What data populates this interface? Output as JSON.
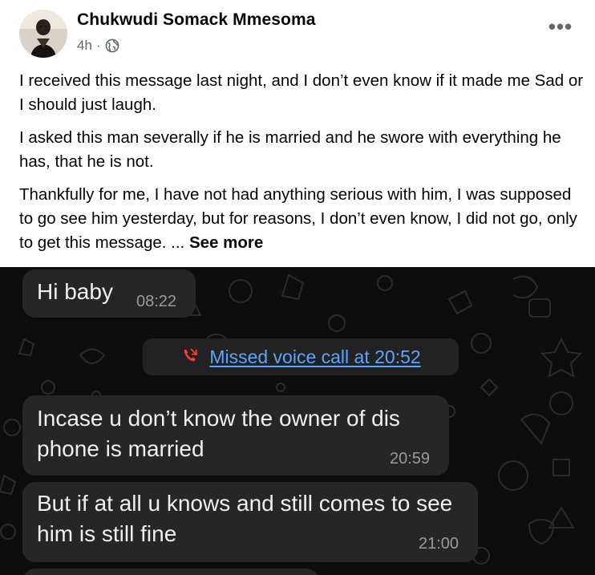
{
  "post": {
    "author_name": "Chukwudi Somack Mmesoma",
    "time": "4h",
    "separator": "·",
    "privacy_icon": "globe-icon",
    "more_icon": "more-horizontal-icon",
    "more_label": "•••",
    "paragraphs": [
      "I received this message last night, and I don’t even know if it made me Sad or I should just laugh.",
      "I asked this man severally if he is married and he swore with everything he has, that he is not.",
      "Thankfully for me, I have not had anything serious with him, I was supposed to go see him yesterday, but for reasons, I don’t even know, I did not go, only to get this message. ..."
    ],
    "see_more": "See more"
  },
  "chat": {
    "colors": {
      "background": "#0d0d0d",
      "bubble": "#262626",
      "link": "#5aa5ff",
      "missed": "#ff3b30"
    },
    "messages": [
      {
        "text": "Hi baby",
        "time": "08:22"
      },
      {
        "text": "Incase u don’t know the owner of dis phone is married",
        "time": "20:59"
      },
      {
        "text": "But if at all u knows and still comes to see him is still fine",
        "time": "21:00"
      }
    ],
    "missed_call": {
      "icon": "missed-call-icon",
      "text": "Missed voice call at 20:52"
    }
  }
}
